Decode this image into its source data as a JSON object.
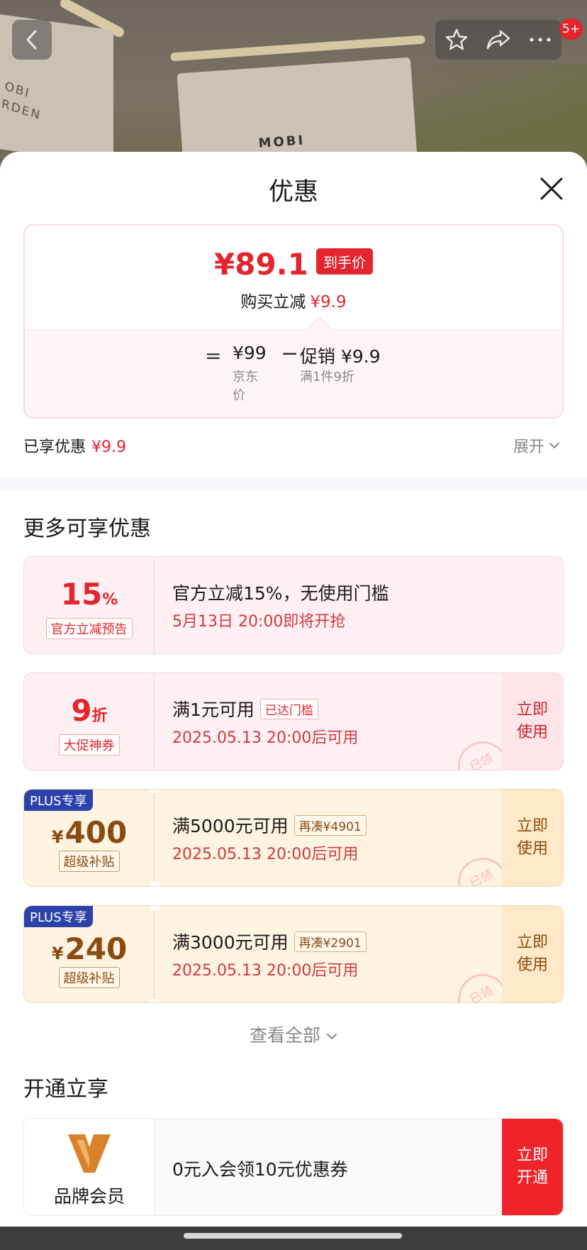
{
  "photo": {
    "brand_left": "OBI\nRDEN",
    "brand_center": "MOBI"
  },
  "top_bar": {
    "message_badge": "5+"
  },
  "sheet": {
    "title": "优惠"
  },
  "price_summary": {
    "final_price": "¥89.1",
    "final_tag": "到手价",
    "reduce_label": "购买立减",
    "reduce_amount": "¥9.9",
    "equals": "=",
    "base_price": "¥99",
    "base_label": "京东\n价",
    "minus": "−",
    "promo_value": "促销 ¥9.9",
    "promo_label": "满1件9折"
  },
  "enjoyed": {
    "label": "已享优惠",
    "amount": "¥9.9",
    "expand": "展开"
  },
  "more_section": {
    "title": "更多可享优惠",
    "coupons": [
      {
        "value": "15",
        "unit": "%",
        "tag": "官方立减预告",
        "line1": "官方立减15%，无使用门槛",
        "line2": "5月13日 20:00即将开抢"
      },
      {
        "value": "9",
        "unit": "折",
        "tag": "大促神券",
        "line1": "满1元可用",
        "line1_tag": "已达门槛",
        "line2": "2025.05.13 20:00后可用",
        "action": "立即\n使用",
        "stamp": "已领"
      },
      {
        "badge": "PLUS专享",
        "currency": "¥",
        "value": "400",
        "tag": "超级补贴",
        "line1": "满5000元可用",
        "line1_tag": "再凑¥4901",
        "line2": "2025.05.13 20:00后可用",
        "action": "立即\n使用",
        "stamp": "已领"
      },
      {
        "badge": "PLUS专享",
        "currency": "¥",
        "value": "240",
        "tag": "超级补贴",
        "line1": "满3000元可用",
        "line1_tag": "再凑¥2901",
        "line2": "2025.05.13 20:00后可用",
        "action": "立即\n使用",
        "stamp": "已领"
      }
    ],
    "view_all": "查看全部"
  },
  "membership": {
    "title": "开通立享",
    "brand": "品牌会员",
    "offer": "0元入会领10元优惠券",
    "action": "立即\n开通"
  },
  "colors": {
    "accent_red": "#e4252e",
    "plus_blue": "#2c41a9",
    "gold_text": "#8a4b10",
    "logo_orange": "#d9822b"
  }
}
